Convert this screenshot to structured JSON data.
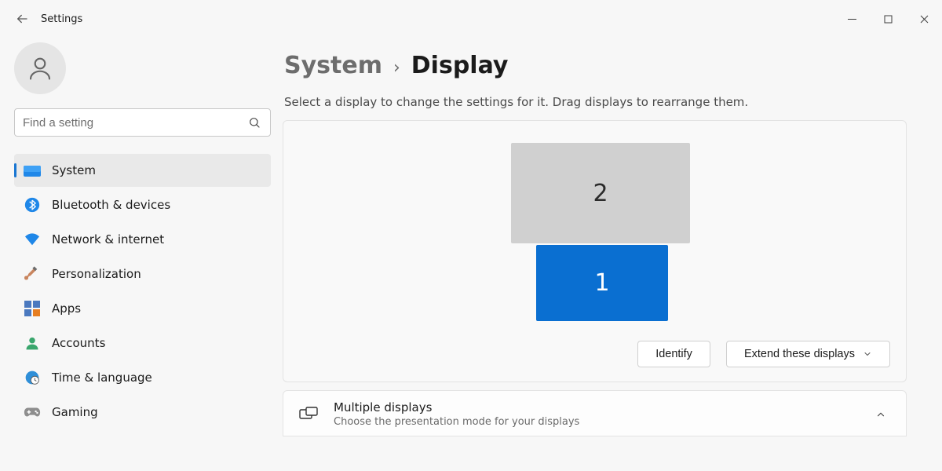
{
  "window": {
    "title": "Settings"
  },
  "search": {
    "placeholder": "Find a setting"
  },
  "sidebar": {
    "items": [
      {
        "label": "System"
      },
      {
        "label": "Bluetooth & devices"
      },
      {
        "label": "Network & internet"
      },
      {
        "label": "Personalization"
      },
      {
        "label": "Apps"
      },
      {
        "label": "Accounts"
      },
      {
        "label": "Time & language"
      },
      {
        "label": "Gaming"
      }
    ]
  },
  "breadcrumb": {
    "parent": "System",
    "current": "Display"
  },
  "main": {
    "subtitle": "Select a display to change the settings for it. Drag displays to rearrange them.",
    "monitors": {
      "primary_label": "1",
      "secondary_label": "2"
    },
    "identify_label": "Identify",
    "mode_dropdown_label": "Extend these displays",
    "multiple_displays": {
      "title": "Multiple displays",
      "desc": "Choose the presentation mode for your displays"
    }
  }
}
